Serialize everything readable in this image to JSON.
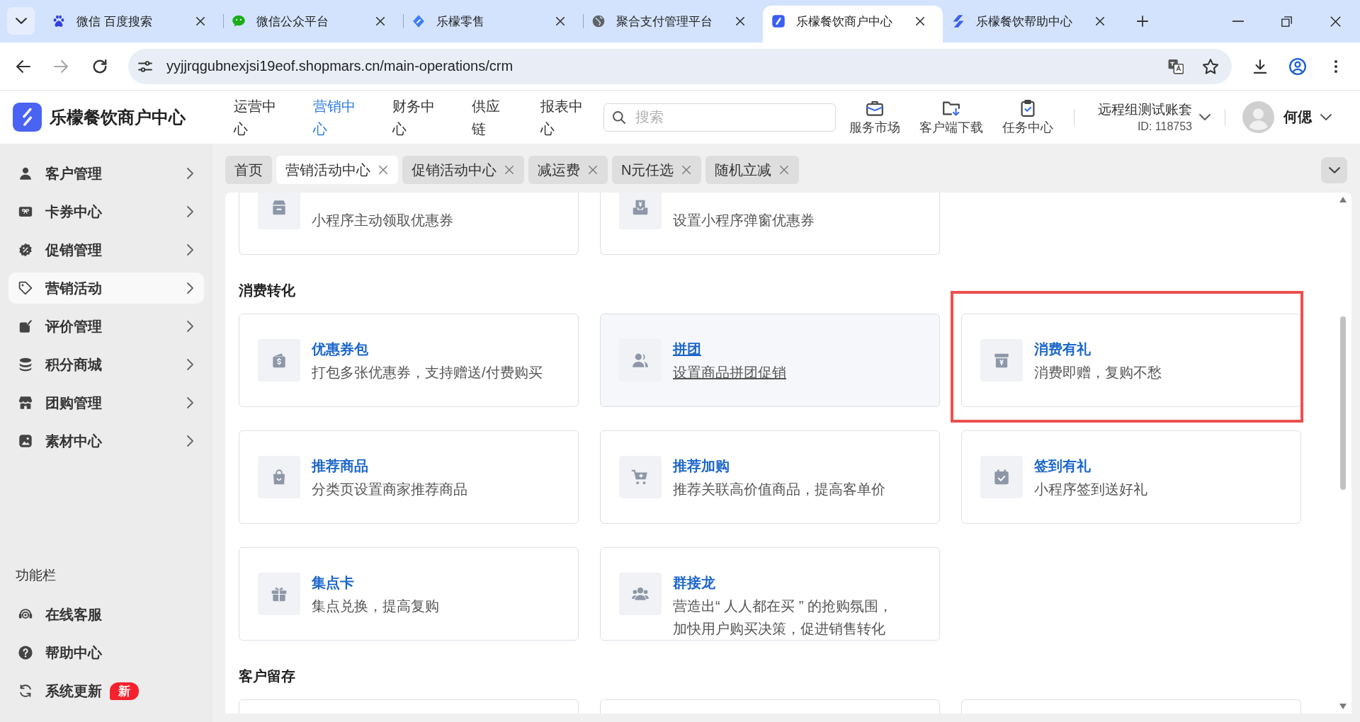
{
  "browser": {
    "tabs": [
      {
        "title": "微信 百度搜索",
        "selected": false
      },
      {
        "title": "微信公众平台",
        "selected": false
      },
      {
        "title": "乐檬零售",
        "selected": false
      },
      {
        "title": "聚合支付管理平台",
        "selected": false
      },
      {
        "title": "乐檬餐饮商户中心",
        "selected": true
      },
      {
        "title": "乐檬餐饮帮助中心",
        "selected": false
      }
    ],
    "forward_enabled": false,
    "url": "yyjjrqgubnexjsi19eof.shopmars.cn/main-operations/crm"
  },
  "header": {
    "brand": "乐檬餐饮商户中心",
    "nav": [
      {
        "label": "运营中心",
        "selected": false
      },
      {
        "label": "营销中心",
        "selected": true
      },
      {
        "label": "财务中心",
        "selected": false
      },
      {
        "label": "供应链",
        "selected": false
      },
      {
        "label": "报表中心",
        "selected": false
      }
    ],
    "search": {
      "placeholder": "搜索"
    },
    "tools": [
      {
        "label": "服务市场"
      },
      {
        "label": "客户端下载"
      },
      {
        "label": "任务中心"
      }
    ],
    "account": {
      "name": "远程组测试账套",
      "id": "ID: 118753"
    },
    "user": {
      "name": "何偲"
    }
  },
  "sidebar": {
    "items": [
      {
        "label": "客户管理",
        "selected": false
      },
      {
        "label": "卡券中心",
        "selected": false
      },
      {
        "label": "促销管理",
        "selected": false
      },
      {
        "label": "营销活动",
        "selected": true
      },
      {
        "label": "评价管理",
        "selected": false
      },
      {
        "label": "积分商城",
        "selected": false
      },
      {
        "label": "团购管理",
        "selected": false
      },
      {
        "label": "素材中心",
        "selected": false
      }
    ],
    "section_title": "功能栏",
    "functions": [
      {
        "label": "在线客服"
      },
      {
        "label": "帮助中心"
      },
      {
        "label": "系统更新",
        "badge": "新"
      }
    ]
  },
  "page_tabs": [
    {
      "label": "首页",
      "selected": false,
      "closable": false
    },
    {
      "label": "营销活动中心",
      "selected": true,
      "closable": true
    },
    {
      "label": "促销活动中心",
      "selected": false,
      "closable": true
    },
    {
      "label": "减运费",
      "selected": false,
      "closable": true
    },
    {
      "label": "N元任选",
      "selected": false,
      "closable": true
    },
    {
      "label": "随机立减",
      "selected": false,
      "closable": true
    }
  ],
  "content": {
    "cut_row": [
      {
        "description": "小程序主动领取优惠券"
      },
      {
        "description": "设置小程序弹窗优惠券"
      }
    ],
    "sections": [
      {
        "title": "消费转化",
        "cards": [
          {
            "kind": "full",
            "title": "优惠券包",
            "description": "打包多张优惠券，支持赠送/付费购买",
            "hovered": false,
            "highlighted": false
          },
          {
            "kind": "full",
            "title": "拼团",
            "description": "设置商品拼团促销",
            "hovered": true,
            "highlighted": false
          },
          {
            "kind": "full",
            "title": "消费有礼",
            "description": "消费即赠，复购不愁",
            "hovered": false,
            "highlighted": true
          },
          {
            "kind": "full",
            "title": "推荐商品",
            "description": "分类页设置商家推荐商品",
            "hovered": false,
            "highlighted": false
          },
          {
            "kind": "full",
            "title": "推荐加购",
            "description": "推荐关联高价值商品，提高客单价",
            "hovered": false,
            "highlighted": false
          },
          {
            "kind": "full",
            "title": "签到有礼",
            "description": "小程序签到送好礼",
            "hovered": false,
            "highlighted": false
          },
          {
            "kind": "full",
            "title": "集点卡",
            "description": "集点兑换，提高复购",
            "hovered": false,
            "highlighted": false
          },
          {
            "kind": "full",
            "title": "群接龙",
            "description": "营造出“ 人人都在买 ” 的抢购氛围，加快用户购买决策，促进销售转化",
            "hovered": false,
            "highlighted": false
          }
        ]
      },
      {
        "title": "客户留存",
        "cards": [
          {
            "kind": "cut"
          },
          {
            "kind": "cut"
          },
          {
            "kind": "cut"
          }
        ]
      }
    ]
  }
}
